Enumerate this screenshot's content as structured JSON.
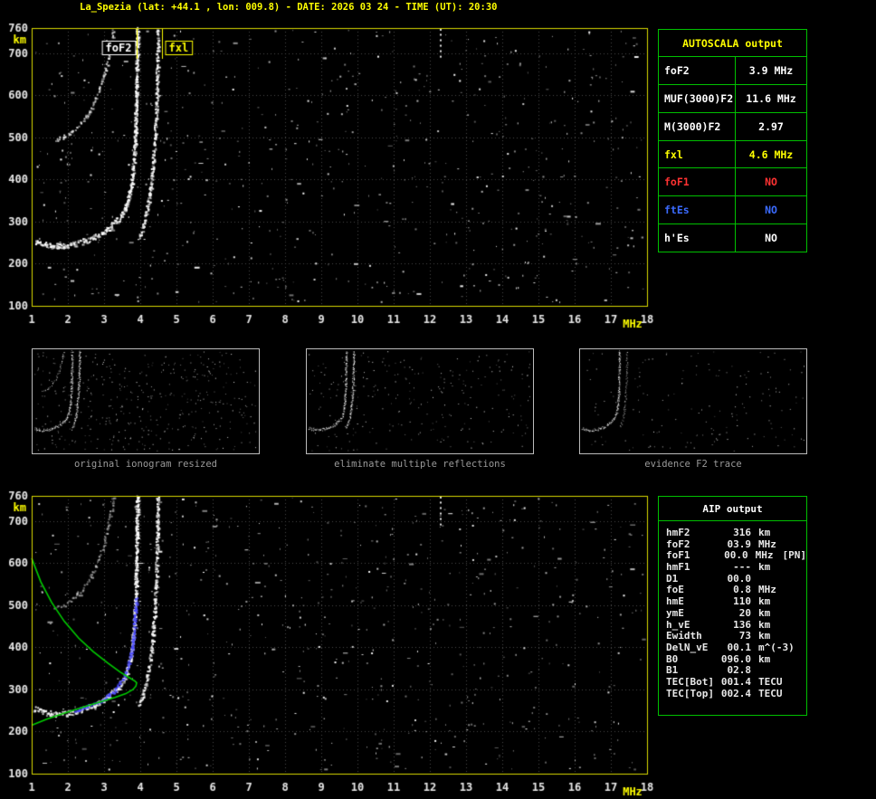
{
  "header": {
    "title": "La_Spezia (lat: +44.1 , lon: 009.8) - DATE: 2026 03 24 - TIME (UT): 20:30"
  },
  "colors": {
    "accent_yellow": "#ffff00",
    "panel_green": "#00c000",
    "foF1_red": "#ff3232",
    "ftEs_blue": "#3b6bff",
    "trace_white": "#ffffff",
    "restored_trace_blue": "#4848ff",
    "profile_green": "#00cc00",
    "caption_gray": "#9a9a9a"
  },
  "autoscala": {
    "title": "AUTOSCALA output",
    "rows": [
      {
        "label": "foF2",
        "value": "3.9 MHz",
        "color": "#ffffff"
      },
      {
        "label": "MUF(3000)F2",
        "value": "11.6 MHz",
        "color": "#ffffff"
      },
      {
        "label": "M(3000)F2",
        "value": "2.97",
        "color": "#ffffff"
      },
      {
        "label": "fxl",
        "value": "4.6 MHz",
        "color": "#ffff00"
      },
      {
        "label": "foF1",
        "value": "NO",
        "color": "#ff3232"
      },
      {
        "label": "ftEs",
        "value": "NO",
        "color": "#3b6bff"
      },
      {
        "label": "h'Es",
        "value": "NO",
        "color": "#ffffff"
      }
    ]
  },
  "aip": {
    "title": "AIP output",
    "rows": [
      {
        "name": "hmF2",
        "value": "316",
        "unit": "km",
        "extra": ""
      },
      {
        "name": "foF2",
        "value": "03.9",
        "unit": "MHz",
        "extra": ""
      },
      {
        "name": "foF1",
        "value": "00.0",
        "unit": "MHz",
        "extra": "[PN]"
      },
      {
        "name": "hmF1",
        "value": "---",
        "unit": "km",
        "extra": ""
      },
      {
        "name": "D1",
        "value": "00.0",
        "unit": "",
        "extra": ""
      },
      {
        "name": "foE",
        "value": "0.8",
        "unit": "MHz",
        "extra": ""
      },
      {
        "name": "hmE",
        "value": "110",
        "unit": "km",
        "extra": ""
      },
      {
        "name": "ymE",
        "value": "20",
        "unit": "km",
        "extra": ""
      },
      {
        "name": "h_vE",
        "value": "136",
        "unit": "km",
        "extra": ""
      },
      {
        "name": "Ewidth",
        "value": "73",
        "unit": "km",
        "extra": ""
      },
      {
        "name": "DelN_vE",
        "value": "00.1",
        "unit": "m^(-3)",
        "extra": ""
      },
      {
        "name": "B0",
        "value": "096.0",
        "unit": "km",
        "extra": ""
      },
      {
        "name": "B1",
        "value": "02.8",
        "unit": "",
        "extra": ""
      },
      {
        "name": "TEC[Bot]",
        "value": "001.4",
        "unit": "TECU",
        "extra": ""
      },
      {
        "name": "TEC[Top]",
        "value": "002.4",
        "unit": "TECU",
        "extra": ""
      }
    ]
  },
  "chart_data": {
    "type": "scatter",
    "description": "Ionogram (virtual height km vs frequency MHz) with autoscaled F2 traces, restored trace and electron density profile",
    "traces": {
      "o_mode": [
        [
          1.1,
          252
        ],
        [
          1.35,
          245
        ],
        [
          1.6,
          241
        ],
        [
          1.9,
          241
        ],
        [
          2.2,
          246
        ],
        [
          2.5,
          254
        ],
        [
          2.8,
          263
        ],
        [
          3.05,
          276
        ],
        [
          3.25,
          291
        ],
        [
          3.45,
          309
        ],
        [
          3.6,
          331
        ],
        [
          3.7,
          358
        ],
        [
          3.78,
          396
        ],
        [
          3.84,
          446
        ],
        [
          3.88,
          510
        ],
        [
          3.9,
          590
        ],
        [
          3.92,
          690
        ],
        [
          3.93,
          760
        ]
      ],
      "x_mode": [
        [
          3.98,
          262
        ],
        [
          4.08,
          285
        ],
        [
          4.18,
          318
        ],
        [
          4.27,
          360
        ],
        [
          4.34,
          412
        ],
        [
          4.4,
          475
        ],
        [
          4.45,
          550
        ],
        [
          4.48,
          640
        ],
        [
          4.5,
          760
        ]
      ],
      "second_hop": [
        [
          1.65,
          492
        ],
        [
          1.85,
          498
        ],
        [
          2.05,
          508
        ],
        [
          2.25,
          522
        ],
        [
          2.45,
          542
        ],
        [
          2.65,
          568
        ],
        [
          2.8,
          596
        ],
        [
          2.95,
          630
        ],
        [
          3.08,
          668
        ],
        [
          3.18,
          710
        ],
        [
          3.28,
          760
        ]
      ],
      "streak": [
        [
          12.3,
          756
        ],
        [
          12.3,
          744
        ],
        [
          12.3,
          731
        ],
        [
          12.3,
          718
        ],
        [
          12.3,
          705
        ],
        [
          12.3,
          692
        ]
      ],
      "restored_blue": [
        [
          2.2,
          249
        ],
        [
          2.45,
          255
        ],
        [
          2.7,
          263
        ],
        [
          2.95,
          273
        ],
        [
          3.15,
          285
        ],
        [
          3.35,
          301
        ],
        [
          3.5,
          319
        ],
        [
          3.62,
          341
        ],
        [
          3.72,
          369
        ],
        [
          3.8,
          406
        ],
        [
          3.85,
          448
        ],
        [
          3.88,
          490
        ],
        [
          3.9,
          520
        ]
      ],
      "profile_green": [
        [
          1.0,
          612
        ],
        [
          1.25,
          556
        ],
        [
          1.55,
          507
        ],
        [
          1.9,
          462
        ],
        [
          2.3,
          422
        ],
        [
          2.7,
          390
        ],
        [
          3.1,
          363
        ],
        [
          3.45,
          341
        ],
        [
          3.7,
          328
        ],
        [
          3.85,
          320
        ],
        [
          3.9,
          316
        ],
        [
          3.88,
          308
        ],
        [
          3.8,
          300
        ],
        [
          3.6,
          290
        ],
        [
          3.3,
          281
        ],
        [
          3.0,
          273
        ],
        [
          2.6,
          263
        ],
        [
          2.2,
          252
        ],
        [
          1.8,
          241
        ],
        [
          1.4,
          229
        ],
        [
          1.0,
          215
        ]
      ]
    },
    "plots": [
      {
        "id": "main",
        "xlabel": "MHz",
        "ylabel": "km",
        "xlim": [
          1,
          18
        ],
        "ylim": [
          100,
          760
        ],
        "xticks": [
          1,
          2,
          3,
          4,
          5,
          6,
          7,
          8,
          9,
          10,
          11,
          12,
          13,
          14,
          15,
          16,
          17,
          18
        ],
        "yticks": [
          100,
          200,
          300,
          400,
          500,
          600,
          700,
          760
        ],
        "grid": true,
        "markers": [
          {
            "label": "foF2",
            "x": 3.9,
            "color": "#ffffff",
            "align": "left"
          },
          {
            "label": "fxl",
            "x": 4.6,
            "color": "#ffff00",
            "align": "right"
          }
        ],
        "series": [
          {
            "ref": "o_mode",
            "color": "#ffffff",
            "spread": 6,
            "density": 3
          },
          {
            "ref": "x_mode",
            "color": "#ffffff",
            "spread": 4,
            "density": 2
          },
          {
            "ref": "second_hop",
            "color": "#ffffff",
            "spread": 3,
            "density": 1.3,
            "alpha": 0.85
          },
          {
            "ref": "streak",
            "color": "#ffffff",
            "style": "dots"
          }
        ],
        "noise": {
          "seed": 101,
          "count": 650
        }
      },
      {
        "id": "bottom",
        "xlabel": "MHz",
        "ylabel": "km",
        "xlim": [
          1,
          18
        ],
        "ylim": [
          100,
          760
        ],
        "xticks": [
          1,
          2,
          3,
          4,
          5,
          6,
          7,
          8,
          9,
          10,
          11,
          12,
          13,
          14,
          15,
          16,
          17,
          18
        ],
        "yticks": [
          100,
          200,
          300,
          400,
          500,
          600,
          700,
          760
        ],
        "grid": true,
        "markers": [],
        "series": [
          {
            "ref": "o_mode",
            "color": "#ffffff",
            "spread": 6,
            "density": 3
          },
          {
            "ref": "x_mode",
            "color": "#ffffff",
            "spread": 4,
            "density": 2
          },
          {
            "ref": "second_hop",
            "color": "#ffffff",
            "spread": 3,
            "density": 1,
            "alpha": 0.6
          },
          {
            "ref": "streak",
            "color": "#ffffff",
            "style": "dots"
          },
          {
            "ref": "restored_blue",
            "color": "#4848ff",
            "spread": 4,
            "density": 2.2
          },
          {
            "ref": "profile_green",
            "color": "#00cc00",
            "style": "line"
          }
        ],
        "noise": {
          "seed": 202,
          "count": 650
        }
      }
    ],
    "thumbnails": [
      {
        "id": "thumb1",
        "caption": "original ionogram resized",
        "series": [
          {
            "ref": "o_mode",
            "color": "#ffffff",
            "spread": 3,
            "density": 2
          },
          {
            "ref": "x_mode",
            "color": "#ffffff",
            "spread": 2,
            "density": 1.5
          },
          {
            "ref": "second_hop",
            "color": "#ffffff",
            "spread": 2,
            "density": 1,
            "alpha": 0.8
          }
        ],
        "noise": {
          "seed": 31,
          "count": 420
        }
      },
      {
        "id": "thumb2",
        "caption": "eliminate multiple reflections",
        "series": [
          {
            "ref": "o_mode",
            "color": "#ffffff",
            "spread": 3,
            "density": 2
          },
          {
            "ref": "x_mode",
            "color": "#ffffff",
            "spread": 2,
            "density": 1.5
          }
        ],
        "noise": {
          "seed": 32,
          "count": 260
        }
      },
      {
        "id": "thumb3",
        "caption": "evidence F2 trace",
        "series": [
          {
            "ref": "o_mode",
            "color": "#ffffff",
            "spread": 3,
            "density": 2
          },
          {
            "ref": "x_mode",
            "color": "#ffffff",
            "spread": 2,
            "density": 1.2,
            "alpha": 0.7
          }
        ],
        "noise": {
          "seed": 33,
          "count": 160
        }
      }
    ]
  }
}
